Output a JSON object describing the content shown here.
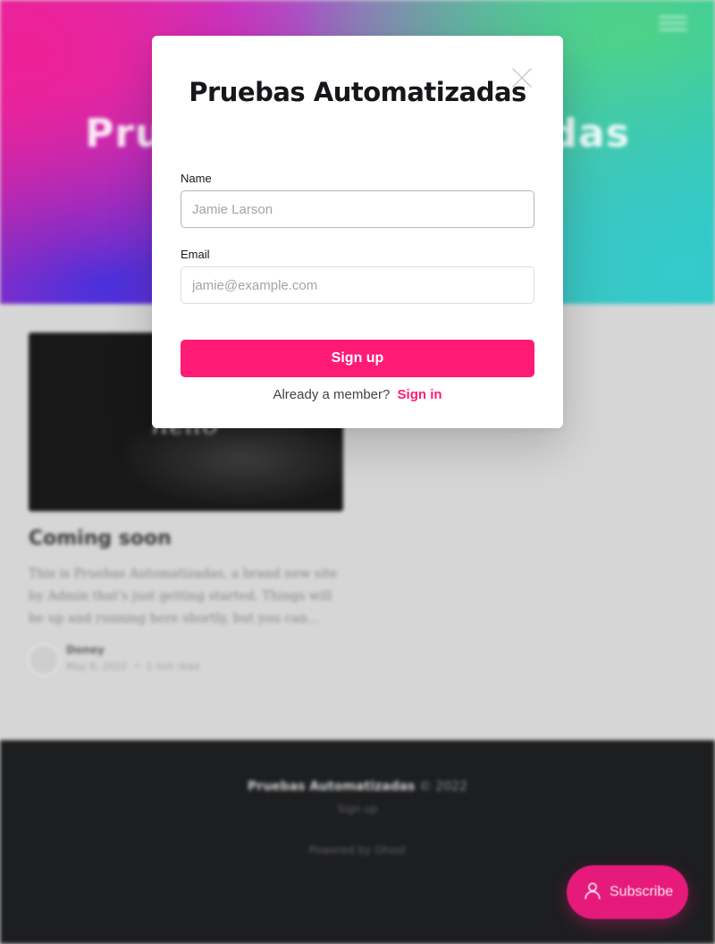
{
  "site": {
    "title": "Pruebas Automatizadas",
    "hero_title": "Pruebas Automatizadas"
  },
  "post": {
    "image_text": "hello",
    "title": "Coming soon",
    "excerpt": "This is Pruebas Automatizadas, a brand new site by Admin that's just getting started. Things will be up and running here shortly, but you can...",
    "author": "Doney",
    "date": "May 8, 2022",
    "separator": "•",
    "read_time": "1 min read"
  },
  "footer": {
    "site_name": "Pruebas Automatizadas",
    "copyright": "© 2022",
    "signup": "Sign up",
    "powered_by": "Powered by Ghost"
  },
  "portal": {
    "subscribe_label": "Subscribe",
    "accent_color": "#ff1a75"
  },
  "modal": {
    "title": "Pruebas Automatizadas",
    "name_label": "Name",
    "name_placeholder": "Jamie Larson",
    "email_label": "Email",
    "email_placeholder": "jamie@example.com",
    "signup_label": "Sign up",
    "member_prompt": "Already a member?",
    "signin_label": "Sign in",
    "close_icon": "close-icon"
  }
}
